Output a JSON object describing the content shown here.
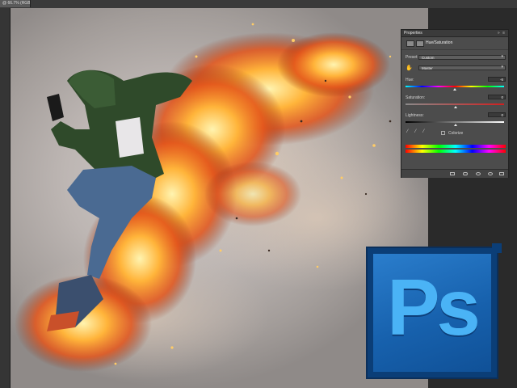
{
  "document": {
    "tab_label": "@ 66.7% (RGB/8) *"
  },
  "properties_panel": {
    "tab_label": "Properties",
    "window_controls": "» ≡",
    "adjustment_title": "Hue/Saturation",
    "preset": {
      "label": "Preset:",
      "value": "Custom"
    },
    "channel": {
      "value": "Master"
    },
    "hue": {
      "label": "Hue:",
      "value": "-6"
    },
    "saturation": {
      "label": "Saturation:",
      "value": "0"
    },
    "lightness": {
      "label": "Lightness:",
      "value": "0"
    },
    "colorize": {
      "label": "Colorize",
      "checked": false
    }
  },
  "logo": {
    "text": "Ps",
    "color": "#4ab3f6",
    "background": "#1761ad"
  },
  "icons": {
    "panel_head": [
      "adjustment-layer-icon",
      "mask-icon"
    ],
    "tools": [
      "eyedropper-icon",
      "eyedropper-plus-icon",
      "eyedropper-minus-icon",
      "hand-target-icon"
    ],
    "footer": [
      "clip-to-layer-icon",
      "view-previous-icon",
      "reset-icon",
      "visibility-icon",
      "trash-icon"
    ]
  }
}
